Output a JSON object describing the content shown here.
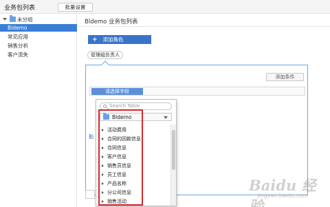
{
  "topbar": {
    "title": "业务包列表",
    "button": "批量设置"
  },
  "sidebar": {
    "group": "未分组",
    "items": [
      {
        "label": "Bldemo",
        "active": true
      },
      {
        "label": "常见应用",
        "active": false
      },
      {
        "label": "销售分析",
        "active": false
      },
      {
        "label": "客户流失",
        "active": false
      }
    ]
  },
  "main": {
    "title": "Bldemo 业务包列表",
    "add_role": "添加角色",
    "manager_tag": "管理组负责人",
    "add_condition": "添加条件",
    "field_select": "请选择字段"
  },
  "popup": {
    "search_placeholder": "Search Table",
    "datasource": "Bldemo",
    "tables": [
      "活动费用",
      "合同的回款信息",
      "合同信息",
      "客户信息",
      "销售员信息",
      "员工信息",
      "产品名称",
      "分公司信息",
      "销售活动"
    ]
  },
  "watermark": {
    "text": "Baidu 经验",
    "url": "jingyan.baidu.com"
  },
  "colors": {
    "accent": "#3a7fd6",
    "highlight": "#d2272d",
    "popup_border": "#6aa6df"
  }
}
